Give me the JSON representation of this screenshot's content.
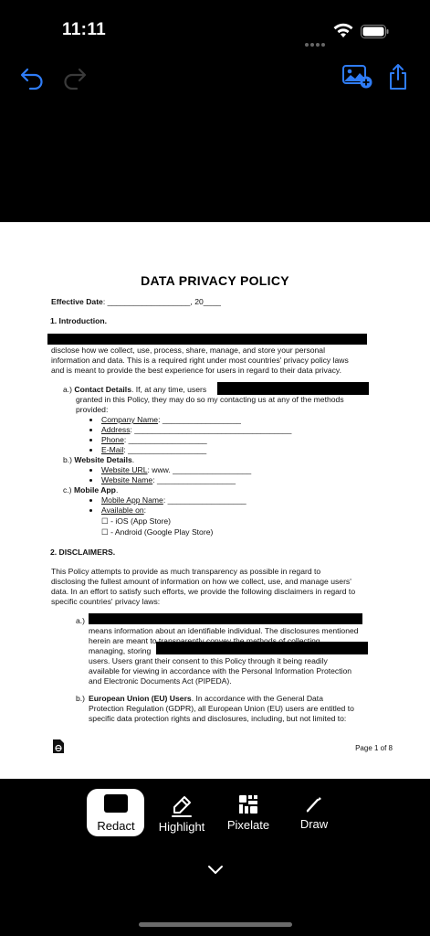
{
  "status_bar": {
    "time": "11:11"
  },
  "toolbar": {
    "undo_icon": "undo-icon",
    "redo_icon": "redo-icon",
    "add_image_icon": "add-image-icon",
    "share_icon": "share-icon"
  },
  "document": {
    "title": "DATA PRIVACY POLICY",
    "effective_date": "Effective Date: ___________________, 20____",
    "effective_date_label": "Effective Date",
    "effective_date_rest": ": ___________________, 20____",
    "sec1": "1.  Introduction.",
    "intro_lines": [
      "disclose how we collect, use, process, share, manage, and store your personal",
      "information and data. This is a required right under most countries' privacy policy laws",
      "and is meant to provide the best experience for users in regard to their data privacy."
    ],
    "a_prefix": "a.)",
    "a_label": "Contact Details",
    "a_text": ". If, at any time, users",
    "a_line2": "granted in this Policy, they may do so my contacting us at any of the methods",
    "a_line3": "provided:",
    "contact_items": [
      {
        "label": "Company Name",
        "blank": ": __________________"
      },
      {
        "label": "Address",
        "blank": ": ____________________________________"
      },
      {
        "label": "Phone",
        "blank": ": __________________"
      },
      {
        "label": "E-Mail",
        "blank": ": __________________"
      }
    ],
    "b_prefix": "b.)",
    "b_label": "Website Details",
    "b_dot": ".",
    "website_items": [
      {
        "label": "Website URL",
        "blank": ": www. __________________"
      },
      {
        "label": "Website Name",
        "blank": ": __________________"
      }
    ],
    "c_prefix": "c.)",
    "c_label": "Mobile App",
    "c_dot": ".",
    "mobile_items": [
      {
        "label": "Mobile App Name",
        "blank": ": __________________"
      },
      {
        "label": "Available on",
        "blank": ":"
      }
    ],
    "store_options": [
      "☐ - iOS (App Store)",
      "☐ - Android (Google Play Store)"
    ],
    "sec2": "2.  DISCLAIMERS.",
    "disclaimer_lines": [
      "This Policy attempts to provide as much transparency as possible in regard to",
      "disclosing the fullest amount of information on how we collect, use, and manage users'",
      "data. In an effort to satisfy such efforts, we provide the following disclaimers in regard to",
      "specific countries' privacy laws:"
    ],
    "d_a_prefix": "a.)",
    "d_a_lines": [
      "means information about an identifiable individual. The disclosures mentioned",
      "herein are meant to transparently convey the methods of collecting,",
      "managing, storing",
      "users. Users grant their consent to this Policy through it being readily",
      "available for viewing in accordance with the Personal Information Protection",
      "and Electronic Documents Act (PIPEDA)."
    ],
    "d_b_prefix": "b.)",
    "d_b_label": "European Union (EU) Users",
    "d_b_text": ". In accordance with the General Data",
    "d_b_lines": [
      "Protection Regulation (GDPR), all European Union (EU) users are entitled to",
      "specific data protection rights and disclosures, including, but not limited to:"
    ],
    "page_number": "Page 1 of 8"
  },
  "tools": [
    {
      "label": "Redact",
      "icon": "redact-icon",
      "selected": true
    },
    {
      "label": "Highlight",
      "icon": "highlighter-icon",
      "selected": false
    },
    {
      "label": "Pixelate",
      "icon": "pixelate-icon",
      "selected": false
    },
    {
      "label": "Draw",
      "icon": "pen-icon",
      "selected": false
    }
  ],
  "colors": {
    "accent": "#2f7cf6",
    "background": "#000000",
    "page": "#ffffff"
  }
}
